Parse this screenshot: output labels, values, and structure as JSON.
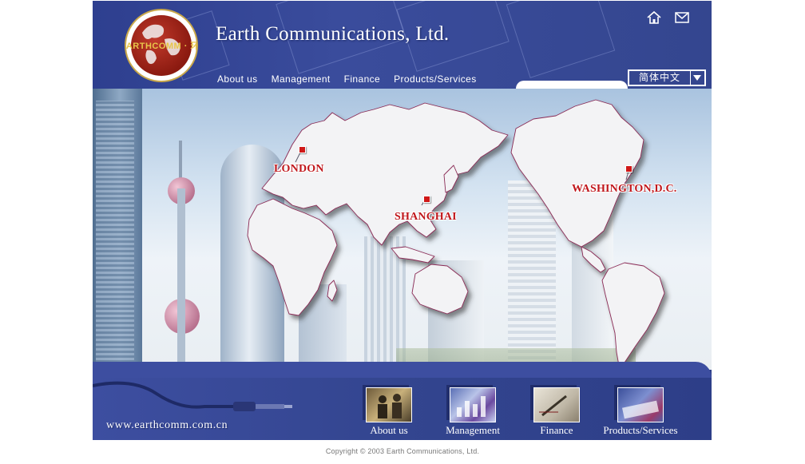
{
  "header": {
    "company_name": "Earth Communications, Ltd.",
    "logo_text": "EARTHCOMM · 环球通讯",
    "nav": [
      "About us",
      "Management",
      "Finance",
      "Products/Services"
    ],
    "language": "简体中文",
    "home_icon": "home-icon",
    "mail_icon": "mail-icon"
  },
  "map": {
    "cities": [
      "LONDON",
      "SHANGHAI",
      "WASHINGTON,D.C."
    ]
  },
  "bottom": {
    "site_url": "www.earthcomm.com.cn",
    "features": [
      "About us",
      "Management",
      "Finance",
      "Products/Services"
    ]
  },
  "footer": {
    "copyright": "Copyright © 2003 Earth Communications, Ltd."
  },
  "colors": {
    "brand_blue": "#34468f",
    "city_red": "#c0171c",
    "logo_red": "#8b1a10"
  }
}
